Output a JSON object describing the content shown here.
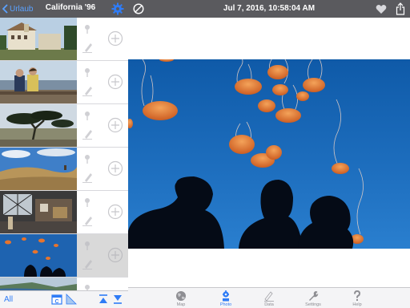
{
  "sidebar": {
    "back_label": "Urlaub",
    "title": "California '96",
    "photos": [
      {
        "scene": "house"
      },
      {
        "scene": "couple"
      },
      {
        "scene": "tree"
      },
      {
        "scene": "hills"
      },
      {
        "scene": "interior"
      },
      {
        "scene": "jellyfish",
        "selected": true
      },
      {
        "scene": "coast"
      }
    ],
    "footer": {
      "all_label": "All",
      "icons": [
        "calendar-sort-icon",
        "ascending-icon",
        "scroll-top-icon",
        "scroll-bottom-icon"
      ]
    }
  },
  "main": {
    "date_title": "Jul 7, 2016, 10:58:04 AM",
    "tabs": [
      {
        "label": "Map",
        "icon": "globe-icon"
      },
      {
        "label": "Photo",
        "icon": "photo-gear-icon",
        "active": true
      },
      {
        "label": "Data",
        "icon": "data-icon"
      },
      {
        "label": "Settings",
        "icon": "wrench-icon"
      },
      {
        "label": "Help",
        "icon": "question-icon"
      }
    ]
  },
  "colors": {
    "bar": "#5a5a5e",
    "accent": "#2f7cf6",
    "water": "#1e63b0",
    "jelly": "#e8742c"
  }
}
